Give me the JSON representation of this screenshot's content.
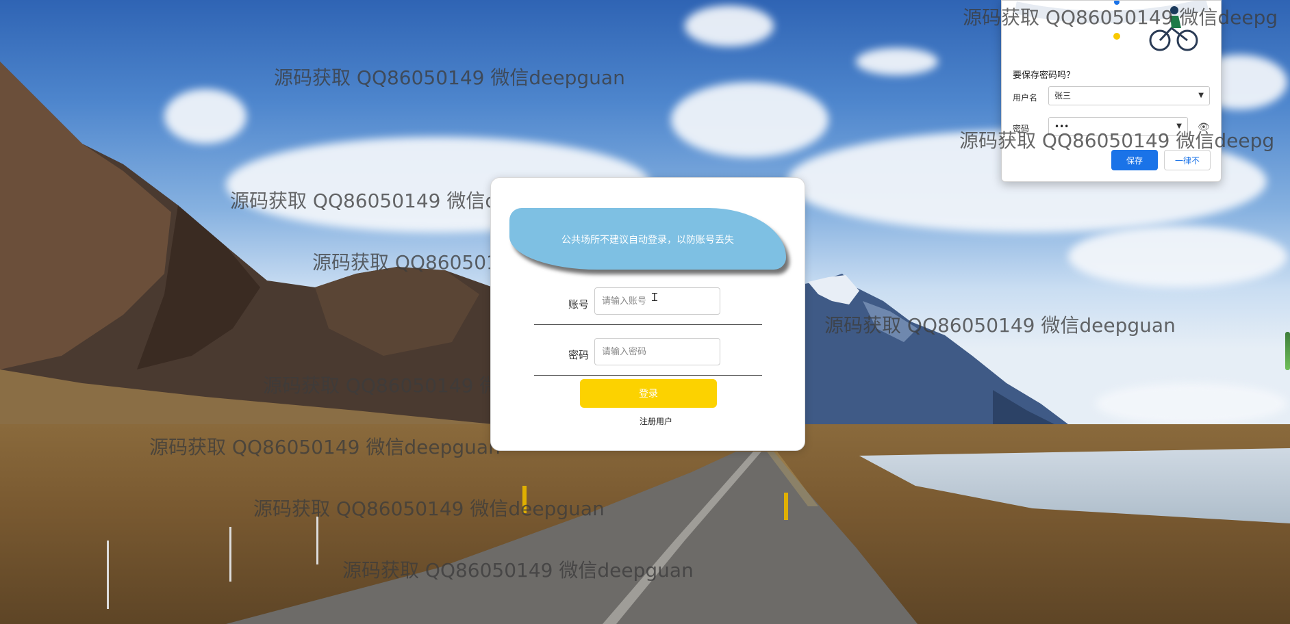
{
  "login": {
    "notice": "公共场所不建议自动登录，以防账号丢失",
    "account_label": "账号",
    "account_placeholder": "请输入账号",
    "password_label": "密码",
    "password_placeholder": "请输入密码",
    "login_button": "登录",
    "register_link": "注册用户"
  },
  "save_password_popup": {
    "title": "要保存密码吗？",
    "username_label": "用户名",
    "username_value": "张三",
    "password_label": "密码",
    "password_value": "•••",
    "save_button": "保存",
    "never_button": "一律不"
  },
  "watermark": {
    "text": "源码获取 QQ86050149 微信deepguan",
    "text_cut": "源码获取 QQ86050149 微信deepg"
  },
  "colors": {
    "notice_bg": "#7ec0e3",
    "login_button_bg": "#fcd200",
    "save_button_bg": "#1a73e8"
  }
}
